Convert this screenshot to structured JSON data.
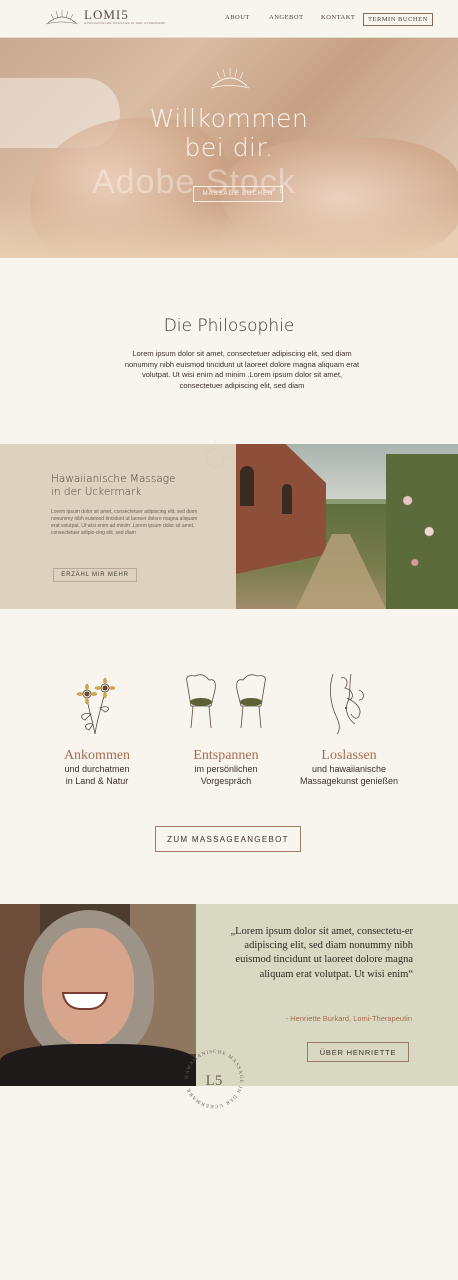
{
  "header": {
    "logo_name": "LOMI5",
    "logo_tagline": "HAWAIIANISCHE MASSAGE IN DER UCKERMARK",
    "nav": [
      "ABOUT",
      "ANGEBOT",
      "KONTAKT"
    ],
    "cta": "TERMIN BUCHEN"
  },
  "hero": {
    "title_line1": "Willkommen",
    "title_line2": "bei dir.",
    "button": "MASSAGE BUCHEN",
    "watermark": "Adobe Stock"
  },
  "philosophy": {
    "title": "Die Philosophie",
    "text": "Lorem ipsum dolor sit amet, consectetuer adipiscing elit, sed diam nonummy nibh euismod tincidunt ut laoreet dolore magna aliquam erat volutpat. Ut wisi enim ad minim .Lorem ipsum dolor sit amet, consectetuer adipiscing elit, sed diam"
  },
  "hawaii": {
    "title_line1": "Hawaiianische Massage",
    "title_line2": "in der Uckermark",
    "text": "Lorem ipsum dolor sit amet, consectetuer adipiscing elit, sed diam nonummy nibh euismod tincidunt ut laoreet dolore magna aliquam erat volutpat. Ut wisi enim ad minim .Lorem ipsum dolor sit amet, consectetuer adipis-cing elit, sed diam",
    "button": "ERZÄHL MIR MEHR"
  },
  "features": [
    {
      "title": "Ankommen",
      "sub_line1": "und durchatmen",
      "sub_line2": "in Land & Natur",
      "icon": "sunflower-icon"
    },
    {
      "title": "Entspannen",
      "sub_line1": "im persönlichen",
      "sub_line2": "Vorgespräch",
      "icon": "chairs-icon"
    },
    {
      "title": "Loslassen",
      "sub_line1": "und hawaiianische",
      "sub_line2": "Massagekunst genießen",
      "icon": "hands-body-icon"
    }
  ],
  "offer_button": "ZUM MASSAGEANGEBOT",
  "testimonial": {
    "quote": "„Lorem ipsum dolor sit amet, consectetu-er adipiscing elit, sed diam nonummy nibh euismod tincidunt ut laoreet dolore magna aliquam erat volutpat. Ut wisi enim“",
    "author": "- Henriette Burkard, Lomi-Therapeutin",
    "button": "ÜBER HENRIETTE"
  },
  "badge": {
    "monogram": "L5",
    "ring_text": "HAWAIIANISCHE MASSAGE IN DER UCKERMARK"
  },
  "colors": {
    "background": "#f8f4ee",
    "accent": "#a76d4e",
    "sand_panel": "#ddd1bf",
    "sage_panel": "#d9d8c3"
  }
}
